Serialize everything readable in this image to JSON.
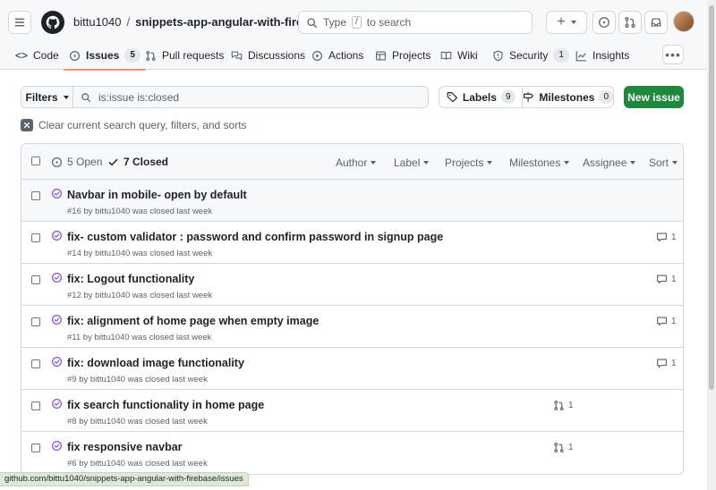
{
  "header": {
    "owner": "bittu1040",
    "separator": "/",
    "repo": "snippets-app-angular-with-firebase",
    "search": {
      "prefix": "Type",
      "key": "/",
      "suffix": "to search"
    }
  },
  "tabs": [
    {
      "label": "Code"
    },
    {
      "label": "Issues",
      "count": "5"
    },
    {
      "label": "Pull requests"
    },
    {
      "label": "Discussions"
    },
    {
      "label": "Actions"
    },
    {
      "label": "Projects"
    },
    {
      "label": "Wiki"
    },
    {
      "label": "Security",
      "count": "1"
    },
    {
      "label": "Insights"
    }
  ],
  "toolbar": {
    "filters_label": "Filters",
    "filter_value": "is:issue is:closed",
    "labels_label": "Labels",
    "labels_count": "9",
    "milestones_label": "Milestones",
    "milestones_count": "0",
    "new_issue_label": "New issue",
    "clear_label": "Clear current search query, filters, and sorts"
  },
  "list_header": {
    "open_label": "5 Open",
    "closed_label": "7 Closed",
    "filters": [
      "Author",
      "Label",
      "Projects",
      "Milestones",
      "Assignee",
      "Sort"
    ]
  },
  "issues": [
    {
      "title": "Navbar in mobile- open by default",
      "meta": "#16 by bittu1040 was closed last week"
    },
    {
      "title": "fix- custom validator : password and confirm password in signup page",
      "meta": "#14 by bittu1040 was closed last week",
      "comments": "1"
    },
    {
      "title": "fix: Logout functionality",
      "meta": "#12 by bittu1040 was closed last week",
      "comments": "1"
    },
    {
      "title": "fix: alignment of home page when empty image",
      "meta": "#11 by bittu1040 was closed last week",
      "comments": "1"
    },
    {
      "title": "fix: download image functionality",
      "meta": "#9 by bittu1040 was closed last week",
      "comments": "1"
    },
    {
      "title": "fix search functionality in home page",
      "meta": "#8 by bittu1040 was closed last week",
      "prs": "1"
    },
    {
      "title": "fix responsive navbar",
      "meta": "#6 by bittu1040 was closed last week",
      "prs": "1"
    }
  ],
  "status_url": "github.com/bittu1040/snippets-app-angular-with-firebase/issues",
  "colors": {
    "closed_purple": "#8250df",
    "primary_green": "#1f883d",
    "tab_underline": "#fd8c73"
  }
}
